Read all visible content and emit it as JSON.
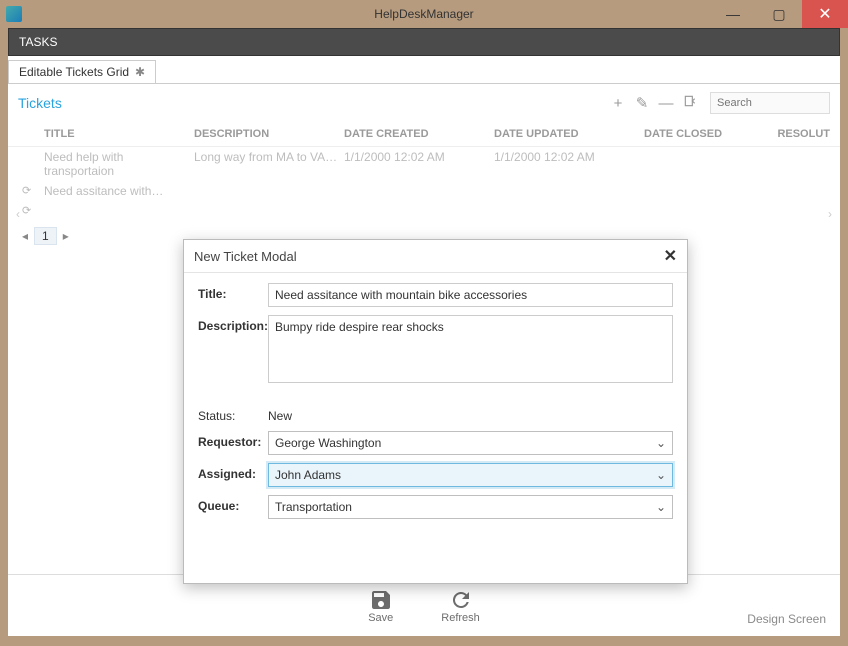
{
  "window": {
    "title": "HelpDeskManager"
  },
  "ribbon": {
    "tab_tasks": "TASKS"
  },
  "doc_tab": {
    "label": "Editable Tickets Grid"
  },
  "tickets": {
    "heading": "Tickets",
    "search_placeholder": "Search",
    "columns": {
      "title": "TITLE",
      "description": "DESCRIPTION",
      "created": "DATE CREATED",
      "updated": "DATE UPDATED",
      "closed": "DATE CLOSED",
      "resolution": "RESOLUT"
    },
    "rows": [
      {
        "title": "Need help with transportaion",
        "description": "Long way from MA to VA…",
        "created": "1/1/2000 12:02 AM",
        "updated": "1/1/2000 12:02 AM"
      },
      {
        "title": "Need assitance with…",
        "description": "",
        "created": "",
        "updated": ""
      }
    ]
  },
  "pager": {
    "current": "1"
  },
  "bottom": {
    "save": "Save",
    "refresh": "Refresh",
    "design": "Design Screen"
  },
  "modal": {
    "title": "New Ticket Modal",
    "labels": {
      "title": "Title:",
      "description": "Description:",
      "status": "Status:",
      "requestor": "Requestor:",
      "assigned": "Assigned:",
      "queue": "Queue:"
    },
    "values": {
      "title": "Need assitance with mountain bike accessories",
      "description": "Bumpy ride despire rear shocks",
      "status": "New",
      "requestor": "George Washington",
      "assigned": "John Adams",
      "queue": "Transportation"
    }
  }
}
